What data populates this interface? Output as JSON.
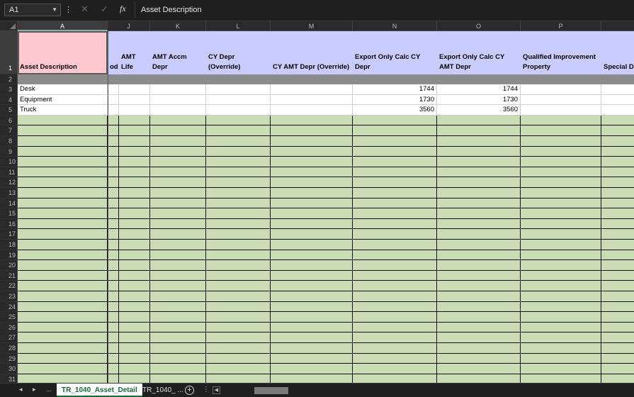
{
  "formula_bar": {
    "name_box": "A1",
    "fx_label": "fx",
    "content": "Asset Description",
    "cancel_icon": "close-icon",
    "enter_icon": "check-icon"
  },
  "columns": [
    {
      "letter": "A",
      "header": "Asset Description"
    },
    {
      "letter": "J",
      "header": "od"
    },
    {
      "letter": "",
      "header": "AMT Life"
    },
    {
      "letter": "K",
      "header": "AMT Accm Depr"
    },
    {
      "letter": "L",
      "header": "CY Depr (Override)"
    },
    {
      "letter": "M",
      "header": "CY AMT Depr (Override)"
    },
    {
      "letter": "N",
      "header": "Export Only Calc CY Depr"
    },
    {
      "letter": "O",
      "header": "Export Only Calc CY AMT Depr"
    },
    {
      "letter": "P",
      "header": "Qualified Improvement Property"
    },
    {
      "letter": "",
      "header": "Special De"
    }
  ],
  "rows": [
    {
      "num": "3",
      "cells": [
        "Desk",
        "",
        "",
        "",
        "",
        "",
        "1744",
        "1744",
        "",
        ""
      ]
    },
    {
      "num": "4",
      "cells": [
        "Equipment",
        "",
        "",
        "",
        "",
        "",
        "1730",
        "1730",
        "",
        ""
      ]
    },
    {
      "num": "5",
      "cells": [
        "Truck",
        "",
        "",
        "",
        "",
        "",
        "3560",
        "3560",
        "",
        ""
      ]
    }
  ],
  "row_numbers": [
    "1",
    "2",
    "3",
    "4",
    "5",
    "6",
    "7",
    "8",
    "9",
    "10",
    "11",
    "12",
    "13",
    "14",
    "15",
    "16",
    "17",
    "18",
    "19",
    "20",
    "21",
    "22",
    "23",
    "24",
    "25",
    "26",
    "27",
    "28",
    "29",
    "30",
    "31"
  ],
  "sheet_tabs": {
    "prev": "◂",
    "next": "▸",
    "more": "...",
    "tabs": [
      "TR_1040_Asset_Detail",
      "TR_1040_ ..."
    ],
    "add": "+",
    "menu": "⋮"
  },
  "colors": {
    "header_fill": "#c9ccff",
    "header_selected_fill": "#ffc7ce",
    "empty_fill": "#c9dcb3",
    "separator_fill": "#8b8b8b",
    "tab_accent": "#1a6b3a"
  }
}
